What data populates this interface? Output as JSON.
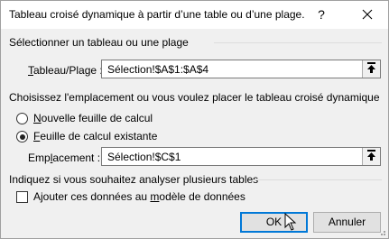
{
  "window": {
    "title": "Tableau croisé dynamique à partir d’une table ou d’une plage.",
    "help_label": "?",
    "close_icon": "close-icon"
  },
  "section_source": {
    "heading": "Sélectionner un tableau ou une plage",
    "field_label_underlined": "T",
    "field_label_rest": "ableau/Plage :",
    "field_value": "Sélection!$A$1:$A$4",
    "button_icon": "collapse-dialog-icon"
  },
  "section_placement": {
    "heading": "Choisissez l'emplacement ou vous voulez placer le tableau croisé dynamique",
    "option_new": {
      "label_underlined": "N",
      "label_rest": "ouvelle feuille de calcul",
      "selected": false
    },
    "option_existing": {
      "label_underlined": "F",
      "label_rest": "euille de calcul existante",
      "selected": true
    },
    "field_label_pre": "Emp",
    "field_label_underlined": "l",
    "field_label_rest": "acement :",
    "field_value": "Sélection!$C$1",
    "button_icon": "collapse-dialog-icon"
  },
  "section_multi": {
    "heading": "Indiquez si vous souhaitez analyser plusieurs tables",
    "checkbox_label_pre": "Ajouter ces données au ",
    "checkbox_label_underlined": "m",
    "checkbox_label_rest": "odèle de données",
    "checked": false
  },
  "buttons": {
    "ok_label": "OK",
    "cancel_label": "Annuler"
  },
  "colors": {
    "dialog_bg": "#f0f0f0",
    "title_bg": "#ffffff",
    "default_button_border": "#0078d7"
  }
}
